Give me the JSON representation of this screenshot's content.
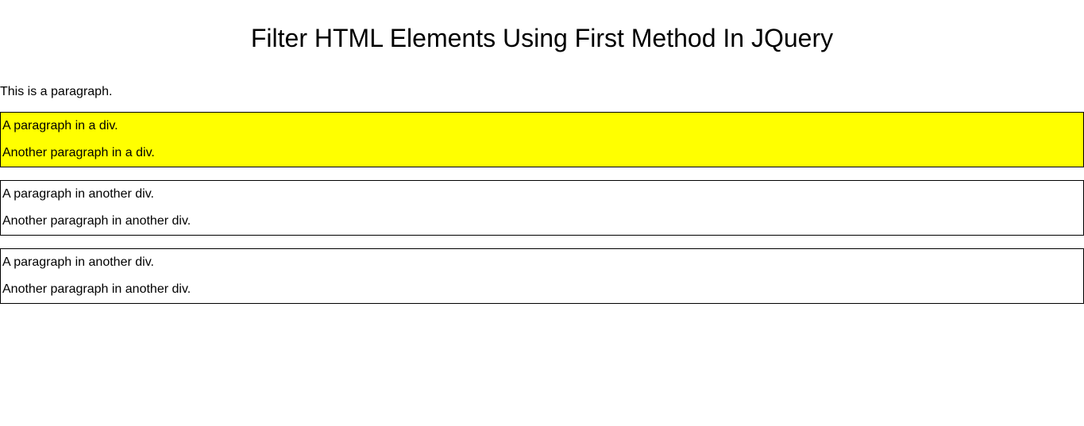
{
  "heading": "Filter HTML Elements Using First Method In JQuery",
  "intro_paragraph": "This is a paragraph.",
  "boxes": [
    {
      "highlighted": true,
      "line1": "A paragraph in a div.",
      "line2": "Another paragraph in a div."
    },
    {
      "highlighted": false,
      "line1": "A paragraph in another div.",
      "line2": "Another paragraph in another div."
    },
    {
      "highlighted": false,
      "line1": "A paragraph in another div.",
      "line2": "Another paragraph in another div."
    }
  ]
}
